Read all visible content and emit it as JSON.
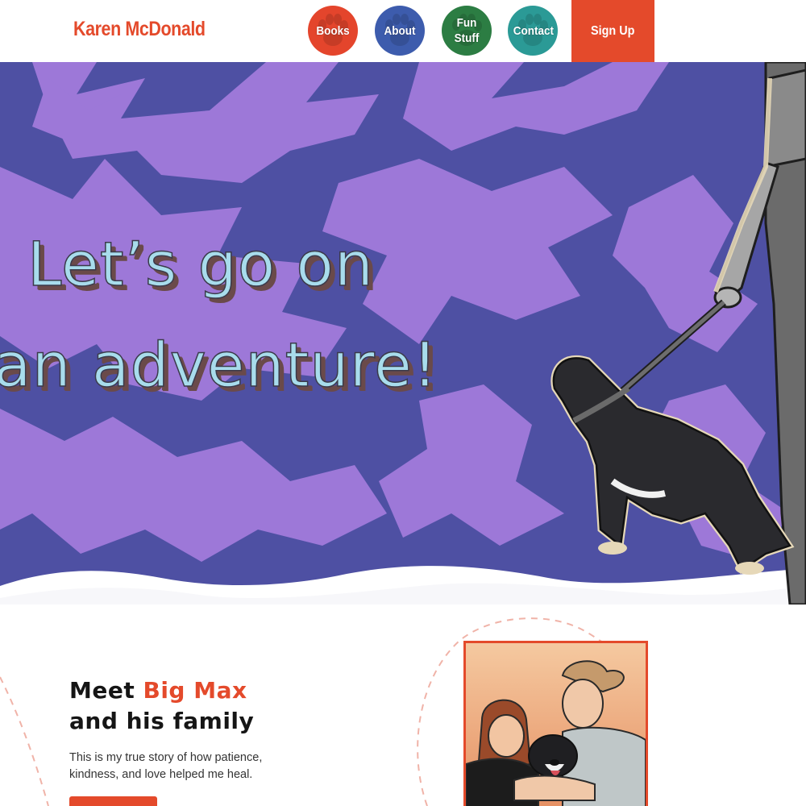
{
  "header": {
    "logo": "Karen McDonald",
    "nav": [
      {
        "label": "Books",
        "color": "#e4452c"
      },
      {
        "label": "About",
        "color": "#3d5cad"
      },
      {
        "label": "Fun Stuff",
        "line1": "Fun",
        "line2": "Stuff",
        "color": "#2c7d43"
      },
      {
        "label": "Contact",
        "color": "#2b9a96"
      }
    ],
    "signup_label": "Sign Up"
  },
  "hero": {
    "headline_line1": "Let’s go on",
    "headline_line2": "an adventure!"
  },
  "intro": {
    "title_prefix": "Meet ",
    "title_highlight": "Big Max",
    "title_suffix": "and his family",
    "body": "This is my true story of how patience, kindness, and love helped me heal."
  },
  "colors": {
    "accent": "#e44a2b",
    "hero_dark": "#4e50a3",
    "hero_light": "#9d78d8",
    "headline_fill": "#a8dcec"
  },
  "icons": [
    "paw-icon"
  ]
}
